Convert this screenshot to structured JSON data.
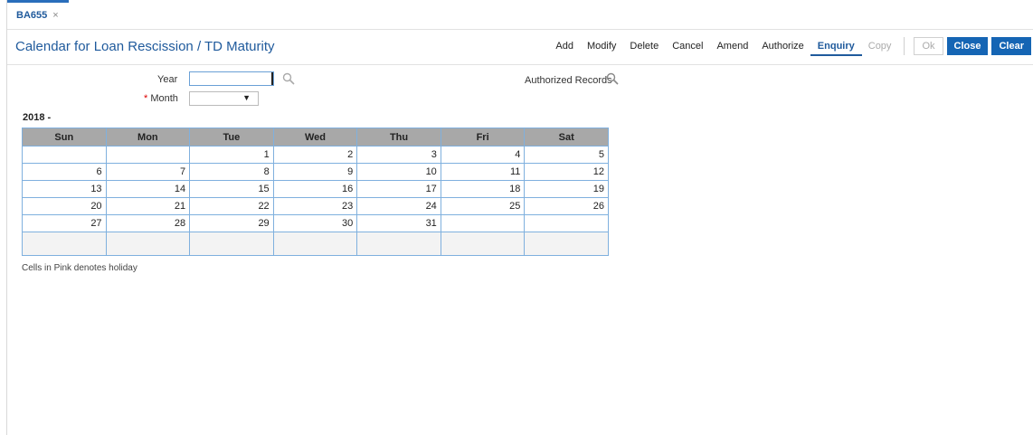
{
  "tab": {
    "label": "BA655",
    "close": "×"
  },
  "header": {
    "title": "Calendar for Loan Rescission / TD Maturity"
  },
  "toolbar": {
    "add": "Add",
    "modify": "Modify",
    "delete": "Delete",
    "cancel": "Cancel",
    "amend": "Amend",
    "authorize": "Authorize",
    "enquiry": "Enquiry",
    "copy": "Copy",
    "ok": "Ok",
    "close": "Close",
    "clear": "Clear"
  },
  "form": {
    "year_label": "Year",
    "year_value": "",
    "month_label": "Month",
    "month_required_marker": "*",
    "month_value": "",
    "authorized_records_label": "Authorized Records"
  },
  "calendar": {
    "heading": "2018 -",
    "days": [
      "Sun",
      "Mon",
      "Tue",
      "Wed",
      "Thu",
      "Fri",
      "Sat"
    ],
    "weeks": [
      [
        "",
        "",
        "1",
        "2",
        "3",
        "4",
        "5"
      ],
      [
        "6",
        "7",
        "8",
        "9",
        "10",
        "11",
        "12"
      ],
      [
        "13",
        "14",
        "15",
        "16",
        "17",
        "18",
        "19"
      ],
      [
        "20",
        "21",
        "22",
        "23",
        "24",
        "25",
        "26"
      ],
      [
        "27",
        "28",
        "29",
        "30",
        "31",
        "",
        ""
      ]
    ]
  },
  "footnote": "Cells in Pink denotes holiday",
  "colors": {
    "accent": "#1f5a9c",
    "button_blue": "#1565b4",
    "header_gray": "#a8a8a8",
    "grid_border": "#7fb0de"
  },
  "icons": {
    "tab_close": "close-icon",
    "year_search": "search-icon",
    "records_search": "search-icon",
    "month_dropdown": "chevron-down-icon"
  }
}
